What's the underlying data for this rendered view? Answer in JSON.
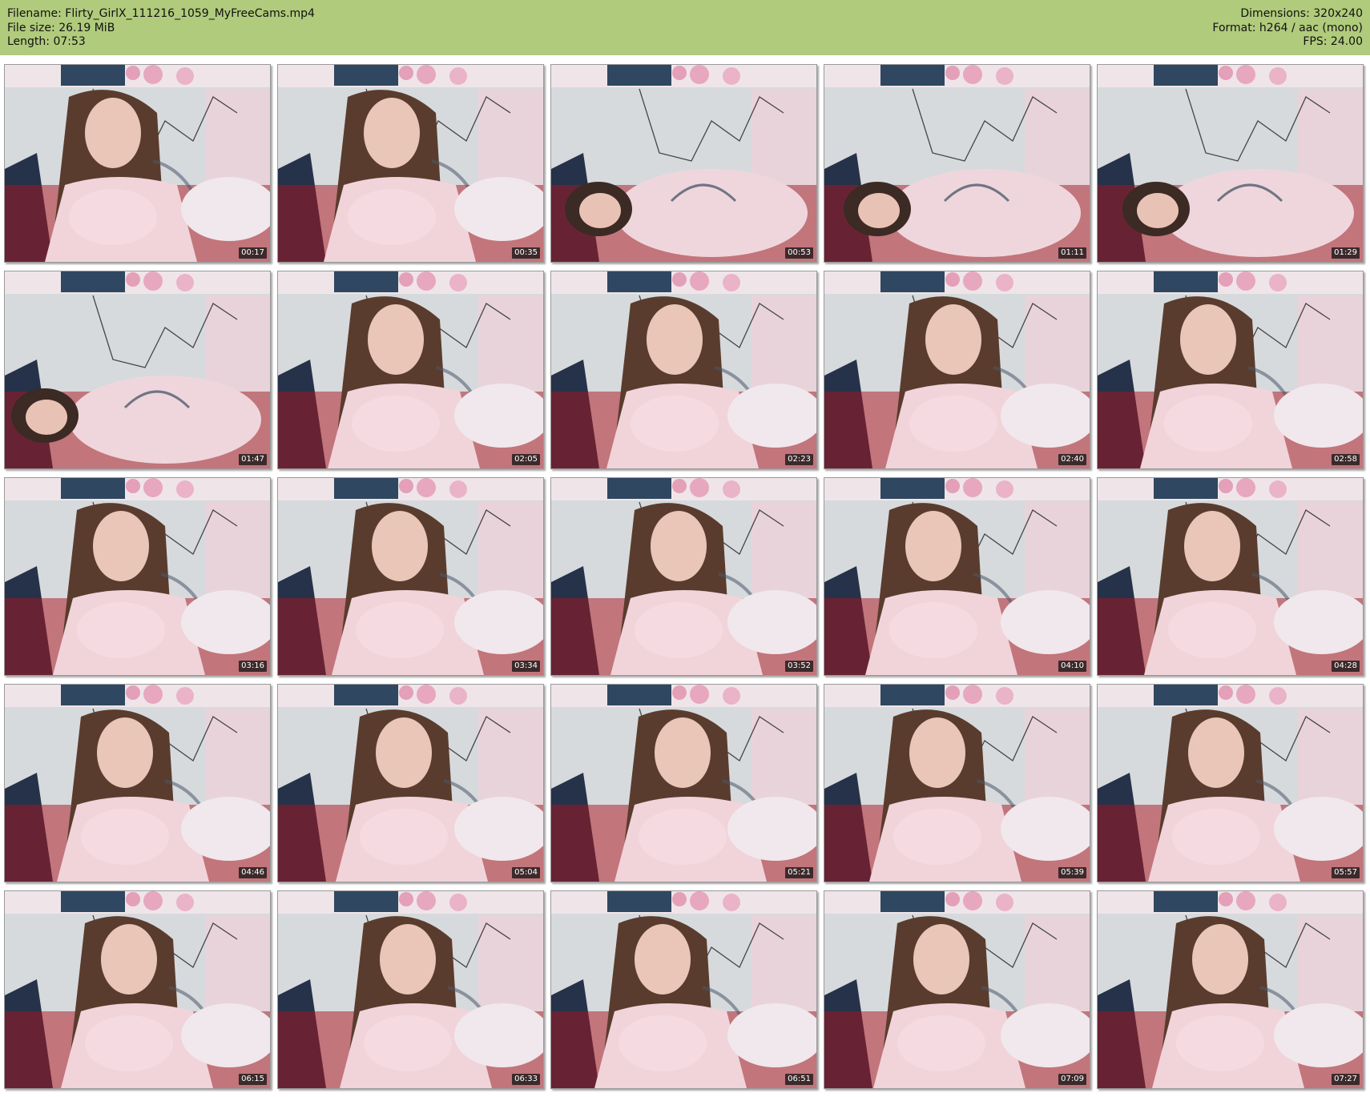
{
  "header": {
    "filename_line": "Filename: Flirty_GirlX_111216_1059_MyFreeCams.mp4",
    "filesize_line": "File size: 26.19 MiB",
    "length_line": "Length: 07:53",
    "dimensions_line": "Dimensions: 320x240",
    "format_line": "Format: h264 / aac (mono)",
    "fps_line": "FPS: 24.00",
    "background_color": "#b0cb7c"
  },
  "thumbnails": [
    {
      "time": "00:17"
    },
    {
      "time": "00:35"
    },
    {
      "time": "00:53"
    },
    {
      "time": "01:11"
    },
    {
      "time": "01:29"
    },
    {
      "time": "01:47"
    },
    {
      "time": "02:05"
    },
    {
      "time": "02:23"
    },
    {
      "time": "02:40"
    },
    {
      "time": "02:58"
    },
    {
      "time": "03:16"
    },
    {
      "time": "03:34"
    },
    {
      "time": "03:52"
    },
    {
      "time": "04:10"
    },
    {
      "time": "04:28"
    },
    {
      "time": "04:46"
    },
    {
      "time": "05:04"
    },
    {
      "time": "05:21"
    },
    {
      "time": "05:39"
    },
    {
      "time": "05:57"
    },
    {
      "time": "06:15"
    },
    {
      "time": "06:33"
    },
    {
      "time": "06:51"
    },
    {
      "time": "07:09"
    },
    {
      "time": "07:27"
    }
  ]
}
